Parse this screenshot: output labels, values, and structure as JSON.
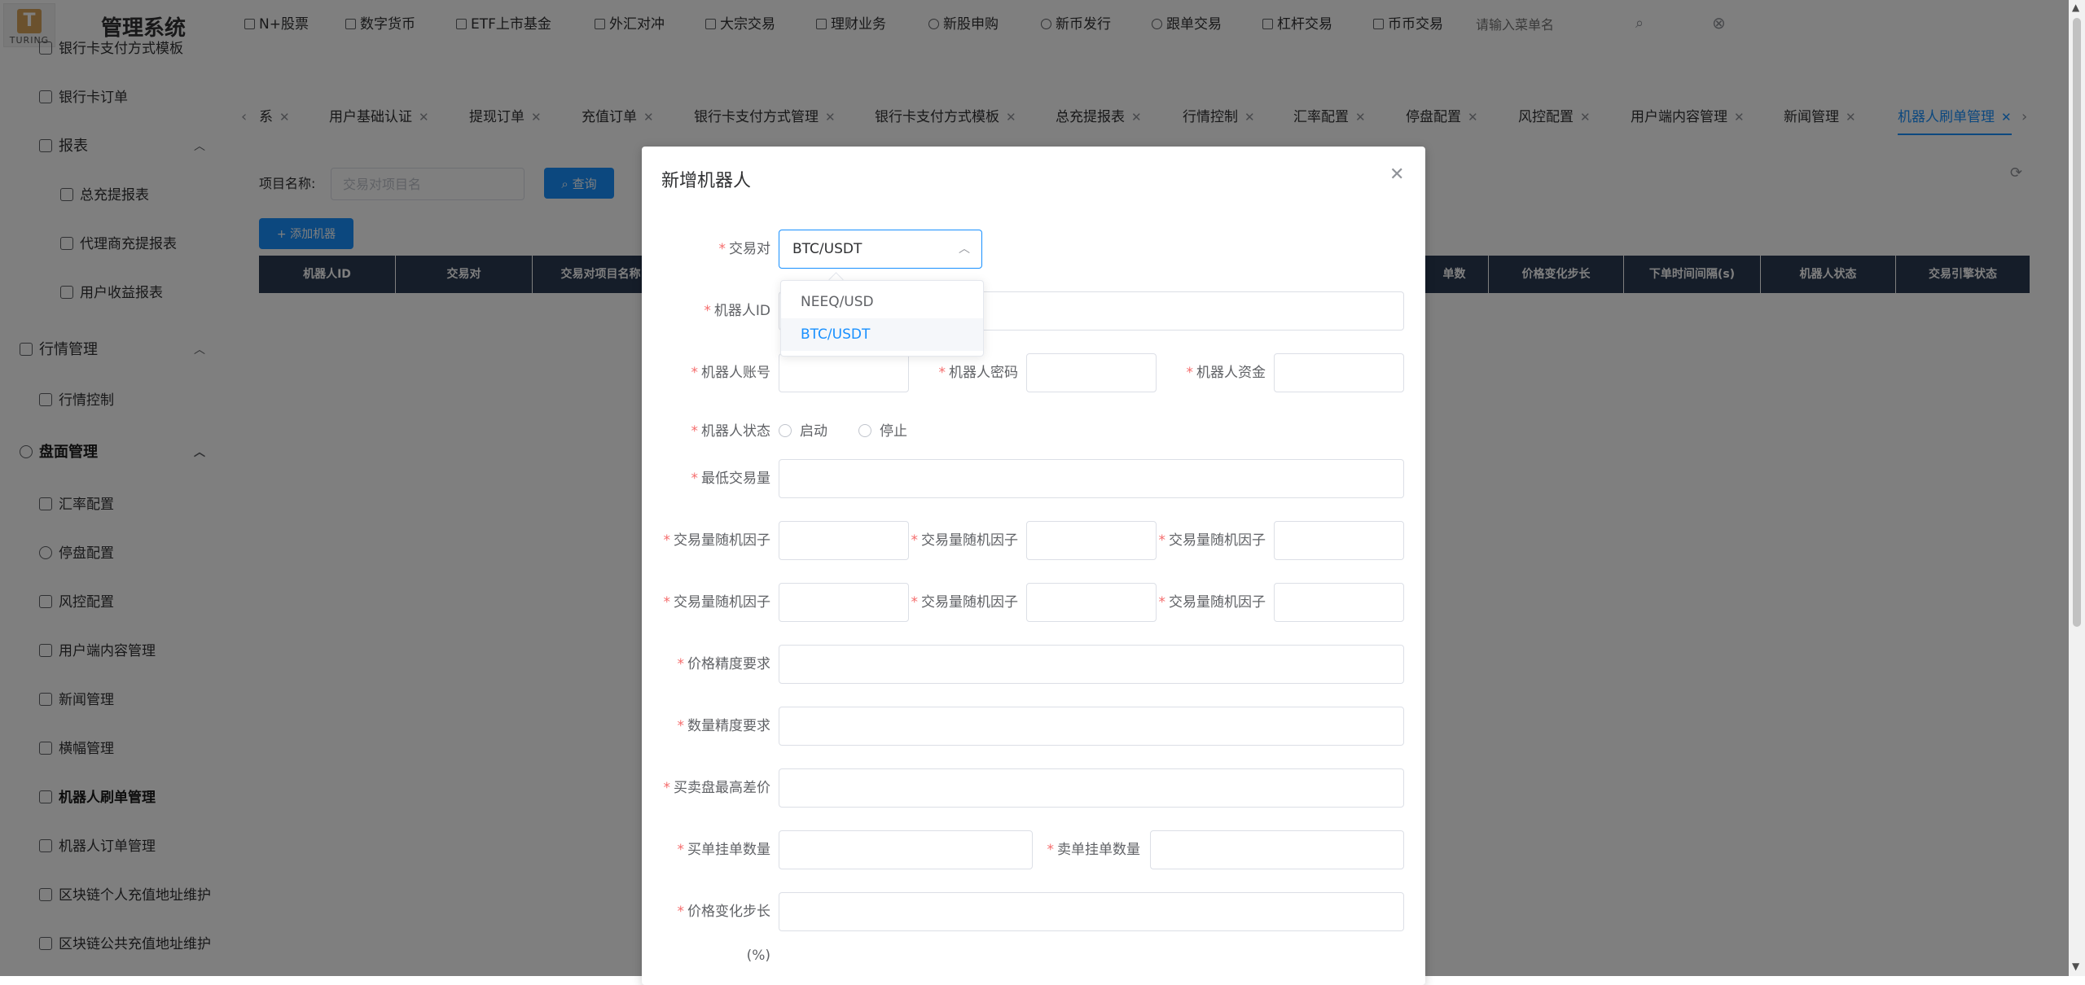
{
  "app": {
    "title": "管理系统",
    "logo_text": "TURING",
    "logo_mark": "T"
  },
  "sidebar": {
    "items": [
      {
        "label": "银行卡支付方式模板",
        "level": 1
      },
      {
        "label": "银行卡订单",
        "level": 1
      },
      {
        "label": "报表",
        "level": 0
      },
      {
        "label": "总充提报表",
        "level": 2
      },
      {
        "label": "代理商充提报表",
        "level": 2
      },
      {
        "label": "用户收益报表",
        "level": 2
      },
      {
        "label": "行情管理",
        "level": 0
      },
      {
        "label": "行情控制",
        "level": 1
      },
      {
        "label": "盘面管理",
        "level": 0
      },
      {
        "label": "汇率配置",
        "level": 1
      },
      {
        "label": "停盘配置",
        "level": 1
      },
      {
        "label": "风控配置",
        "level": 1
      },
      {
        "label": "用户端内容管理",
        "level": 1
      },
      {
        "label": "新闻管理",
        "level": 1
      },
      {
        "label": "横幅管理",
        "level": 1
      },
      {
        "label": "机器人刷单管理",
        "level": 1
      },
      {
        "label": "机器人订单管理",
        "level": 1
      },
      {
        "label": "区块链个人充值地址维护",
        "level": 1
      },
      {
        "label": "区块链公共充值地址维护",
        "level": 1
      }
    ]
  },
  "topnav": {
    "items": [
      "N+股票",
      "数字货币",
      "ETF上市基金",
      "外汇对冲",
      "大宗交易",
      "理财业务",
      "新股申购",
      "新币发行",
      "跟单交易",
      "杠杆交易",
      "币币交易"
    ],
    "search_placeholder": "请输入菜单名"
  },
  "tabs": {
    "items": [
      "系",
      "用户基础认证",
      "提现订单",
      "充值订单",
      "银行卡支付方式管理",
      "银行卡支付方式模板",
      "总充提报表",
      "行情控制",
      "汇率配置",
      "停盘配置",
      "风控配置",
      "用户端内容管理",
      "新闻管理",
      "机器人刷单管理"
    ],
    "active": "机器人刷单管理"
  },
  "filter": {
    "label": "项目名称:",
    "placeholder": "交易对项目名",
    "query_button": "查询",
    "add_button": "+ 添加机器"
  },
  "table": {
    "columns": [
      "机器人ID",
      "交易对",
      "交易对项目名称",
      "单数",
      "价格变化步长",
      "下单时间间隔(s)",
      "机器人状态",
      "交易引擎状态"
    ]
  },
  "dialog": {
    "title": "新增机器人",
    "fields": {
      "pair": "交易对",
      "robot_id": "机器人ID",
      "account": "机器人账号",
      "password": "机器人密码",
      "funds": "机器人资金",
      "status": "机器人状态",
      "min_volume": "最低交易量",
      "random_factor": "交易量随机因子",
      "price_precision": "价格精度要求",
      "qty_precision": "数量精度要求",
      "max_spread": "买卖盘最高差价",
      "buy_orders": "买单挂单数量",
      "sell_orders": "卖单挂单数量",
      "price_step": "价格变化步长",
      "price_step_unit": "(%)"
    },
    "status_options": {
      "start": "启动",
      "stop": "停止"
    },
    "selected_pair": "BTC/USDT",
    "dropdown_options": [
      "NEEQ/USD",
      "BTC/USDT"
    ]
  },
  "colors": {
    "primary": "#1890ff",
    "required": "#f56c6c",
    "header": "#2b3a52"
  }
}
